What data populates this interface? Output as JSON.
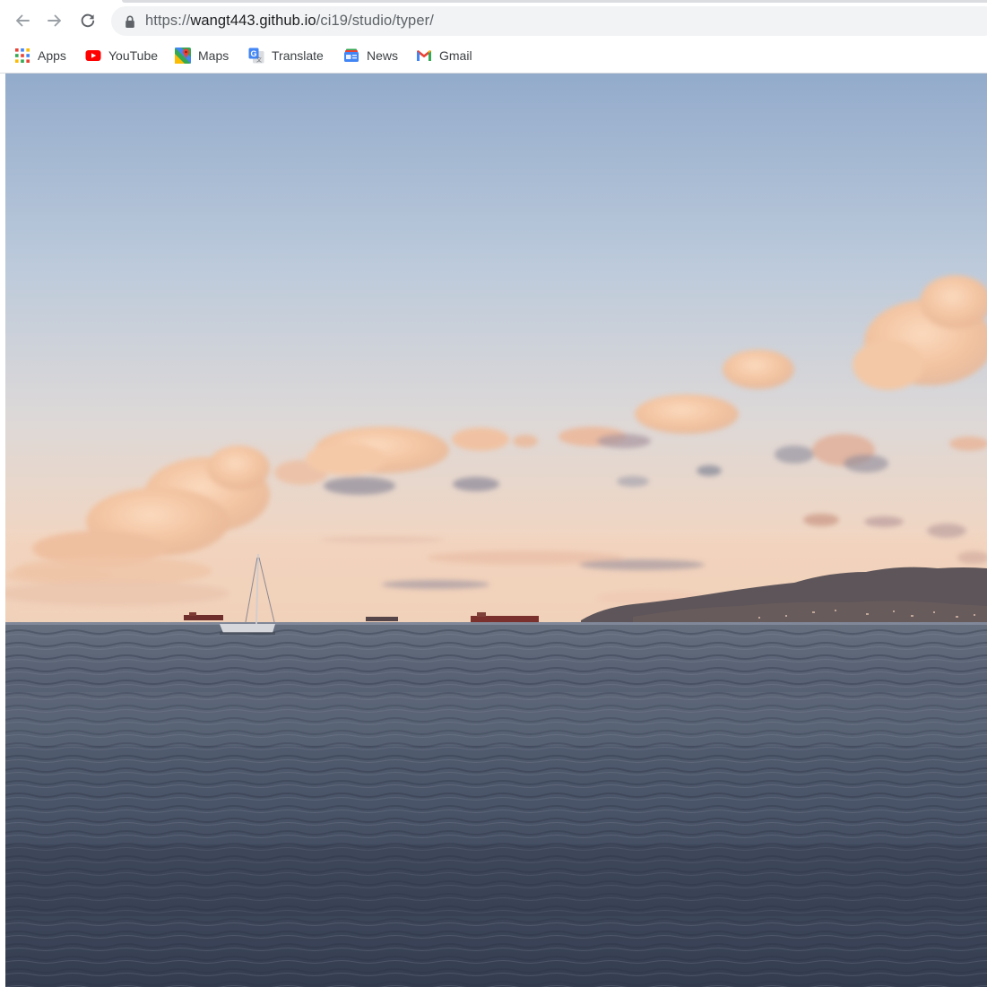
{
  "browser": {
    "url": {
      "scheme": "https://",
      "host": "wangt443.github.io",
      "path": "/ci19/studio/typer/"
    },
    "nav": {
      "back_icon": "arrow-left-icon",
      "forward_icon": "arrow-right-icon",
      "reload_icon": "reload-icon",
      "lock_icon": "lock-icon"
    }
  },
  "bookmarks": [
    {
      "label": "Apps",
      "icon": "apps-grid-icon"
    },
    {
      "label": "YouTube",
      "icon": "youtube-icon"
    },
    {
      "label": "Maps",
      "icon": "maps-icon"
    },
    {
      "label": "Translate",
      "icon": "translate-icon"
    },
    {
      "label": "News",
      "icon": "news-icon"
    },
    {
      "label": "Gmail",
      "icon": "gmail-icon"
    }
  ],
  "page": {
    "content": "video-frame",
    "scene_colors": {
      "sky_top": "#93abcb",
      "sky_mid": "#c7d2dd",
      "sky_horizon": "#f1d2b8",
      "sea_near": "#3a4457",
      "sea_far": "#5a6577",
      "cloud": "#f3c3a0",
      "hill": "#5b5358"
    }
  }
}
